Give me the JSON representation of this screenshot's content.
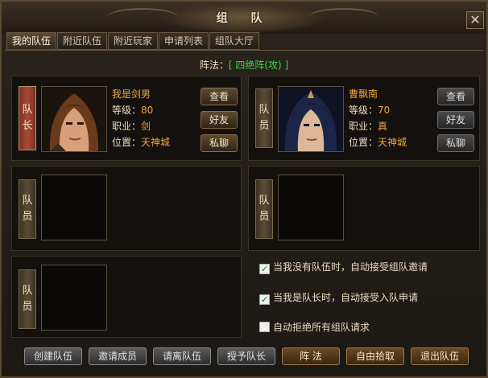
{
  "window": {
    "title": "组 队",
    "close_glyph": "✕"
  },
  "tabs": [
    "我的队伍",
    "附近队伍",
    "附近玩家",
    "申请列表",
    "组队大厅"
  ],
  "formation": {
    "label": "阵法：",
    "value": "[ 四绝阵(攻) ]"
  },
  "roles": {
    "leader": [
      "队",
      "长"
    ],
    "member": [
      "队",
      "员"
    ]
  },
  "members": [
    {
      "name": "我是剑男",
      "level_label": "等级：",
      "level": "80",
      "job_label": "职业：",
      "job": "剑",
      "loc_label": "位置：",
      "loc": "天神城"
    },
    {
      "name": "曹飘南",
      "level_label": "等级：",
      "level": "70",
      "job_label": "职业：",
      "job": "真",
      "loc_label": "位置：",
      "loc": "天神城"
    }
  ],
  "slot_buttons": {
    "view": "查看",
    "friend": "好友",
    "chat": "私聊"
  },
  "options": [
    {
      "label": "当我没有队伍时，自动接受组队邀请",
      "checked": true
    },
    {
      "label": "当我是队长时，自动接受入队申请",
      "checked": true
    },
    {
      "label": "自动拒绝所有组队请求",
      "checked": false
    }
  ],
  "bottom_buttons": [
    "创建队伍",
    "邀请成员",
    "请离队伍",
    "授予队长",
    "阵 法",
    "自由拾取",
    "退出队伍"
  ],
  "colors": {
    "accent_orange": "#f0a63a",
    "formation_green": "#35d84a"
  }
}
